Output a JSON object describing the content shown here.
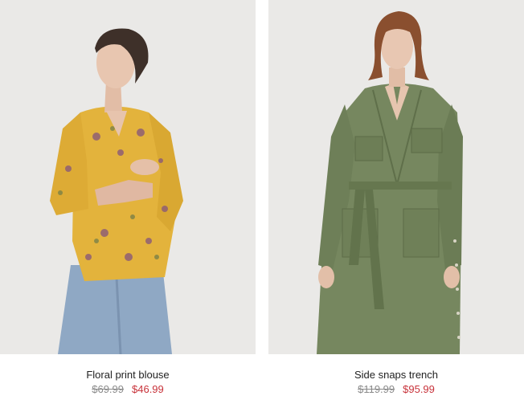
{
  "products": [
    {
      "name": "Floral print blouse",
      "original_price": "$69.99",
      "sale_price": "$46.99",
      "image": "model-in-yellow-floral-blouse-and-jeans"
    },
    {
      "name": "Side snaps trench",
      "original_price": "$119.99",
      "sale_price": "$95.99",
      "image": "model-in-olive-belted-trench-dress"
    }
  ],
  "colors": {
    "photo_background": "#e9e8e6",
    "sale_price": "#c8323a",
    "original_price": "#8a8a8a",
    "name_text": "#222222"
  }
}
